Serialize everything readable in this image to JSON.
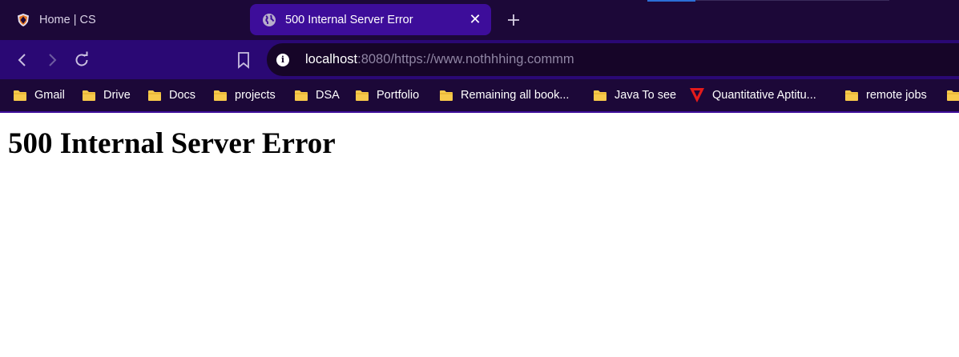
{
  "tabs": [
    {
      "title": "Home | CS",
      "active": false,
      "icon": "shield-crest-icon"
    },
    {
      "title": "500 Internal Server Error",
      "active": true,
      "icon": "globe-icon"
    }
  ],
  "toolbar": {
    "back_icon": "arrow-left-icon",
    "forward_icon": "arrow-right-icon",
    "reload_icon": "reload-icon",
    "bookmark_icon": "bookmark-icon",
    "site_info_icon": "info-icon"
  },
  "address_bar": {
    "host": "localhost",
    "rest": ":8080/https://www.nothhhing.commm"
  },
  "bookmarks": [
    {
      "label": "Gmail",
      "icon": "folder-icon"
    },
    {
      "label": "Drive",
      "icon": "folder-icon"
    },
    {
      "label": "Docs",
      "icon": "folder-icon"
    },
    {
      "label": "projects",
      "icon": "folder-icon"
    },
    {
      "label": "DSA",
      "icon": "folder-icon"
    },
    {
      "label": "Portfolio",
      "icon": "folder-icon"
    },
    {
      "label": "Remaining all book...",
      "icon": "folder-icon"
    },
    {
      "label": "Java To see",
      "icon": "folder-icon"
    },
    {
      "label": "Quantitative Aptitu...",
      "icon": "red-v-logo-icon"
    },
    {
      "label": "remote jobs",
      "icon": "folder-icon"
    },
    {
      "label": "",
      "icon": "folder-icon"
    }
  ],
  "page": {
    "heading": "500 Internal Server Error"
  },
  "colors": {
    "tab_strip_bg": "#1c0838",
    "active_tab_bg": "#3d0d9a",
    "toolbar_bg": "#2a0874",
    "omnibox_bg": "#160528",
    "folder_yellow": "#f7c94b",
    "page_bg": "#ffffff"
  }
}
